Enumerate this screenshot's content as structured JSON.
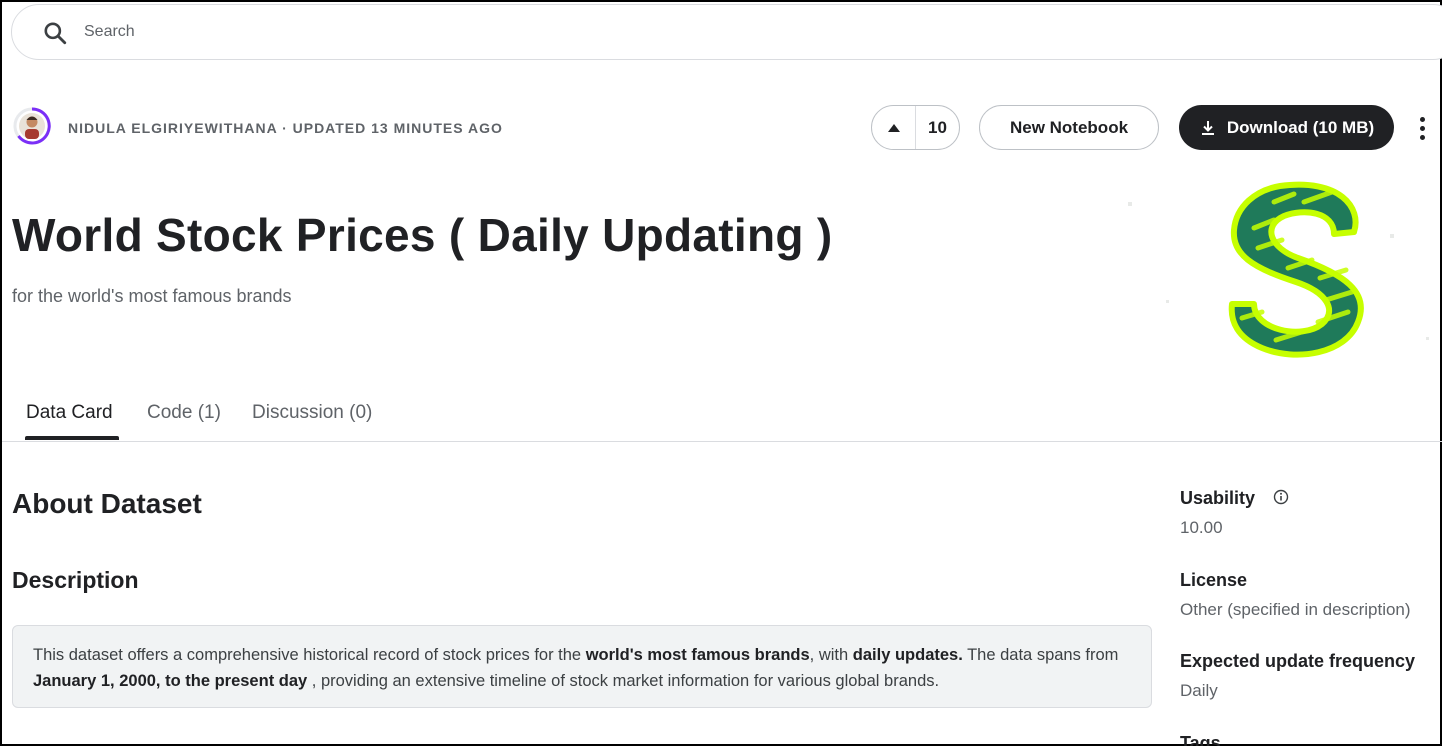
{
  "search": {
    "placeholder": "Search"
  },
  "header": {
    "byline": "NIDULA ELGIRIYEWITHANA · UPDATED 13 MINUTES AGO",
    "vote_count": "10",
    "new_notebook_label": "New Notebook",
    "download_label": "Download (10 MB)"
  },
  "dataset": {
    "title": "World Stock Prices ( Daily Updating )",
    "subtitle": "for the world's most famous brands"
  },
  "tabs": [
    {
      "label": "Data Card",
      "active": true
    },
    {
      "label": "Code (1)",
      "active": false
    },
    {
      "label": "Discussion (0)",
      "active": false
    }
  ],
  "main": {
    "about_heading": "About Dataset",
    "description_heading": "Description",
    "description": {
      "t1": "This dataset offers a comprehensive historical record of stock prices for the ",
      "b1": "world's most famous brands",
      "t2": ", with ",
      "b2": "daily updates.",
      "t3": " The data spans from ",
      "b3": "January 1, 2000, to the present day",
      "t4": " , providing an extensive timeline of stock market information for various global brands."
    }
  },
  "sidebar": {
    "usability_label": "Usability",
    "usability_value": "10.00",
    "license_label": "License",
    "license_value": "Other (specified in description)",
    "frequency_label": "Expected update frequency",
    "frequency_value": "Daily",
    "tags_label": "Tags"
  },
  "icons": {
    "search": "search-icon",
    "upvote": "arrow-up-icon",
    "download": "download-icon",
    "more": "more-vert-icon",
    "info": "info-icon"
  },
  "colors": {
    "primary_dark": "#202124",
    "muted_text": "#5f6368",
    "avatar_ring": "#7b2ff7",
    "cover_green": "#4caf50",
    "cover_lime": "#c6ff00"
  }
}
